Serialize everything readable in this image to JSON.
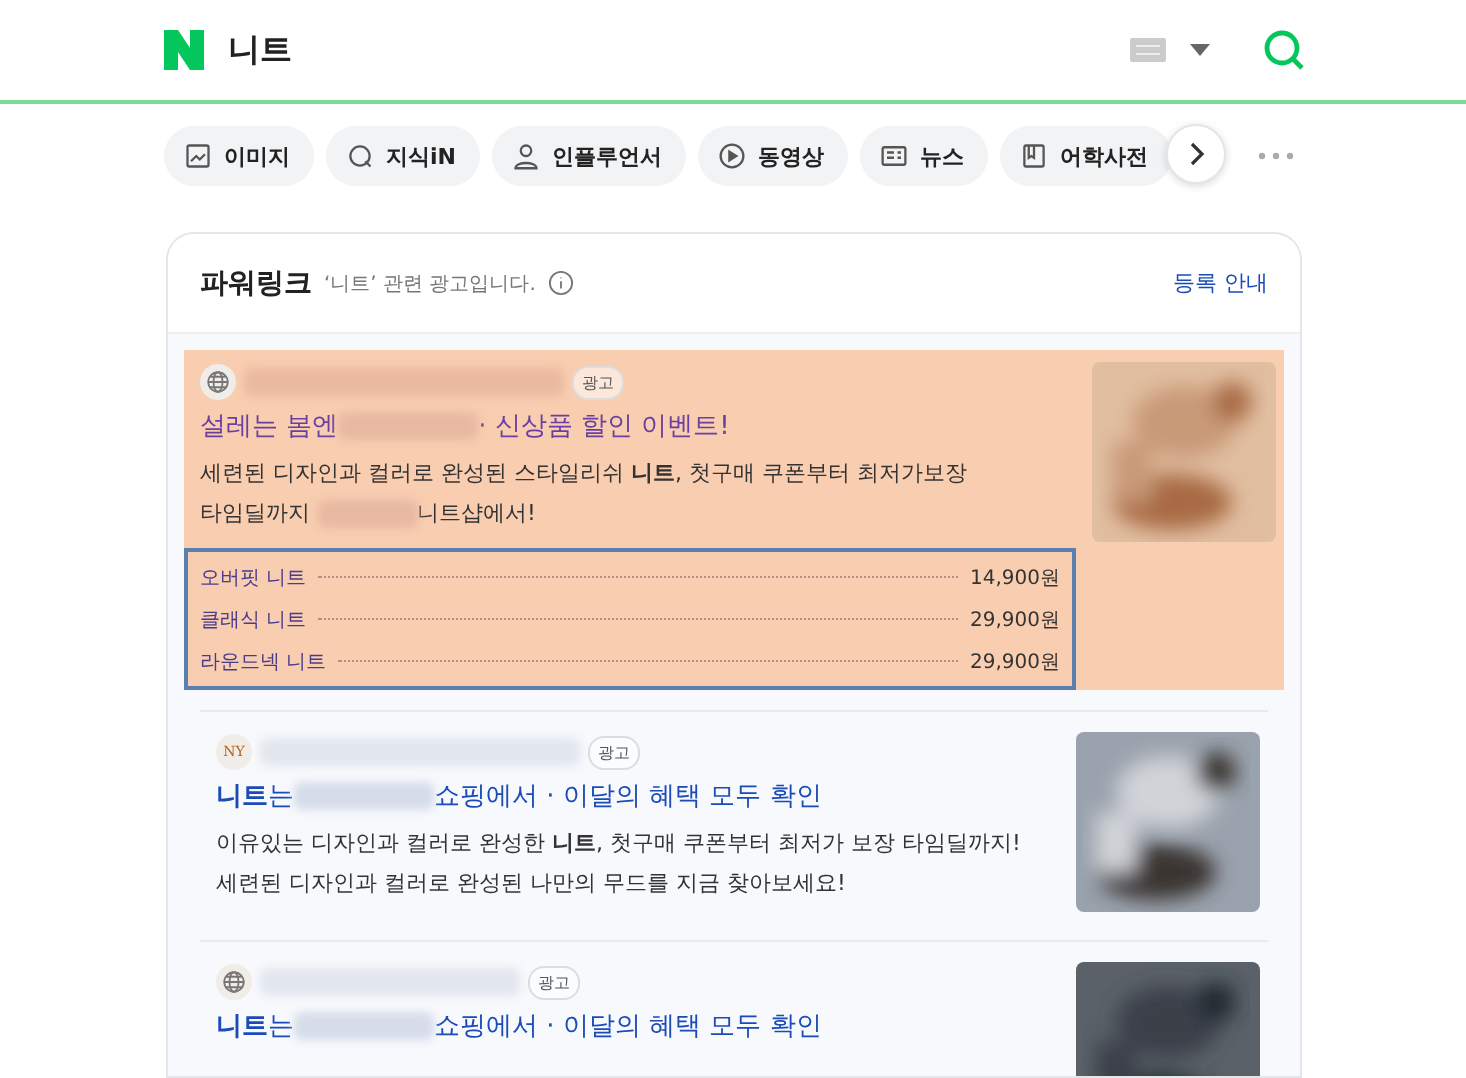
{
  "header": {
    "query": "니트"
  },
  "tabs": [
    {
      "label": "이미지",
      "selected": false
    },
    {
      "label": "지식iN",
      "selected": false
    },
    {
      "label": "인플루언서",
      "selected": false
    },
    {
      "label": "동영상",
      "selected": false
    },
    {
      "label": "뉴스",
      "selected": false
    },
    {
      "label": "어학사전",
      "selected": false
    }
  ],
  "powerlink": {
    "title": "파워링크",
    "subtitle": "‘니트’ 관련 광고입니다.",
    "register": "등록 안내",
    "ads": [
      {
        "highlighted": true,
        "favicon": {
          "kind": "globe"
        },
        "badge": "광고",
        "title": [
          {
            "kind": "text",
            "text": "설레는 봄엔"
          },
          {
            "kind": "blur"
          },
          {
            "kind": "text",
            "text": "· 신상품 할인 이벤트!"
          }
        ],
        "description": [
          {
            "kind": "text",
            "text": "세련된 디자인과 컬러로 완성된 스타일리쉬 **니트**, 첫구매 쿠폰부터 최저가보장"
          },
          {
            "kind": "break"
          },
          {
            "kind": "text",
            "text": "타임딜까지 "
          },
          {
            "kind": "blur"
          },
          {
            "kind": "text",
            "text": "니트샵에서!"
          }
        ],
        "sublinks": [
          {
            "name": "오버핏 니트",
            "price": "14,900원"
          },
          {
            "name": "클래식 니트",
            "price": "29,900원"
          },
          {
            "name": "라운드넥 니트",
            "price": "29,900원"
          }
        ]
      },
      {
        "highlighted": false,
        "favicon": {
          "kind": "monogram",
          "text": "NY"
        },
        "badge": "광고",
        "title": [
          {
            "kind": "text",
            "text": "**니트**는"
          },
          {
            "kind": "blur"
          },
          {
            "kind": "text",
            "text": "쇼핑에서 · 이달의 혜택 모두 확인"
          }
        ],
        "description": [
          {
            "kind": "text",
            "text": "이유있는 디자인과 컬러로 완성한 **니트**, 첫구매 쿠폰부터 최저가 보장 타임딜까지!"
          },
          {
            "kind": "break"
          },
          {
            "kind": "text",
            "text": "세련된 디자인과 컬러로 완성된 나만의 무드를 지금 찾아보세요!"
          }
        ]
      },
      {
        "highlighted": false,
        "favicon": {
          "kind": "globe"
        },
        "badge": "광고",
        "title": [
          {
            "kind": "text",
            "text": "**니트**는"
          },
          {
            "kind": "blur"
          },
          {
            "kind": "text",
            "text": "쇼핑에서 · 이달의 혜택 모두 확인"
          }
        ]
      }
    ]
  }
}
